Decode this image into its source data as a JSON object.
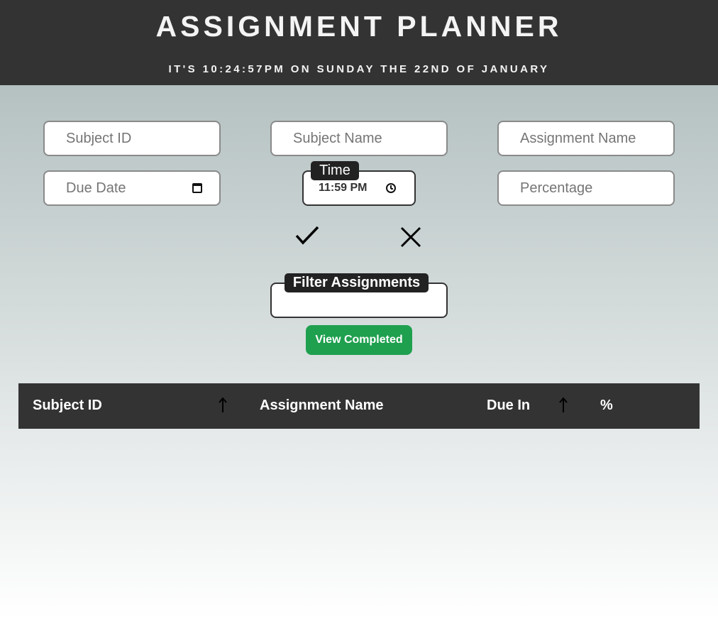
{
  "header": {
    "title": "ASSIGNMENT PLANNER",
    "clock": "IT'S 10:24:57PM ON SUNDAY THE 22ND OF JANUARY"
  },
  "form": {
    "subject_id_placeholder": "Subject ID",
    "subject_name_placeholder": "Subject Name",
    "assignment_name_placeholder": "Assignment Name",
    "due_date_placeholder": "Due Date",
    "time_label": "Time",
    "time_value": "11:59 PM",
    "percentage_placeholder": "Percentage",
    "confirm_icon": "check-icon",
    "cancel_icon": "close-icon"
  },
  "filter": {
    "label": "Filter Assignments",
    "value": "",
    "view_completed_label": "View Completed"
  },
  "table": {
    "columns": [
      {
        "label": "Subject ID",
        "sortable": true,
        "sort_icon": "arrow-up-icon"
      },
      {
        "label": "Assignment Name",
        "sortable": false
      },
      {
        "label": "Due In",
        "sortable": true,
        "sort_icon": "arrow-up-icon"
      },
      {
        "label": "%",
        "sortable": false
      }
    ],
    "rows": []
  },
  "colors": {
    "header_bg": "#333333",
    "accent_green": "#1fa04f",
    "label_bg": "#222222"
  }
}
